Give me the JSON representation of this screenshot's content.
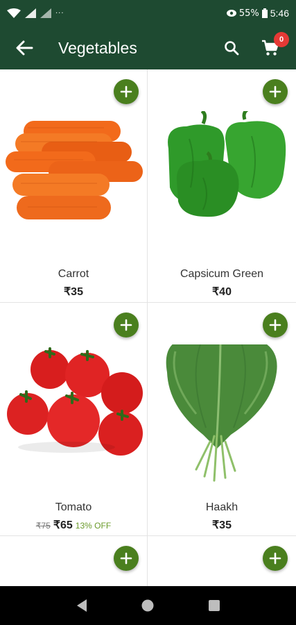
{
  "status_bar": {
    "battery": "55%",
    "time": "5:46",
    "more": "···"
  },
  "app_bar": {
    "title": "Vegetables",
    "cart_count": "0"
  },
  "products": [
    {
      "name": "Carrot",
      "price": "₹35"
    },
    {
      "name": "Capsicum Green",
      "price": "₹40"
    },
    {
      "name": "Tomato",
      "old_price": "₹75",
      "price": "₹65",
      "discount": "13% OFF"
    },
    {
      "name": "Haakh",
      "price": "₹35"
    }
  ],
  "colors": {
    "app_bar": "#1e4a31",
    "add_button": "#4a7f1e",
    "badge": "#e53935",
    "discount_text": "#6a9a2a"
  },
  "icons": [
    "back-arrow-icon",
    "search-icon",
    "cart-icon",
    "plus-icon",
    "nav-back-icon",
    "nav-home-icon",
    "nav-recents-icon"
  ]
}
